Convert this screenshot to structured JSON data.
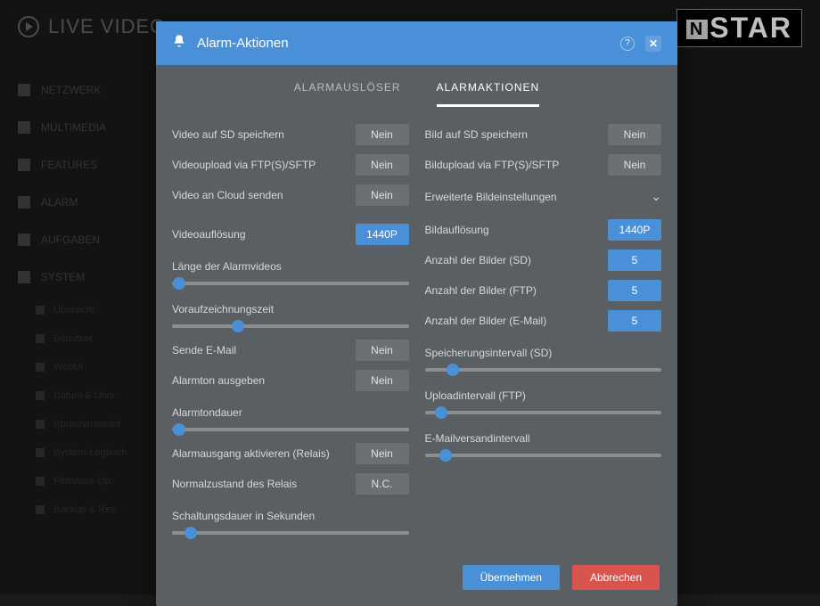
{
  "background": {
    "page_title": "LIVE VIDEO",
    "logo": "STAR",
    "logo_prefix": "N",
    "nav": [
      "NETZWERK",
      "MULTIMEDIA",
      "FEATURES",
      "ALARM",
      "AUFGABEN",
      "SYSTEM"
    ],
    "sub": [
      "Übersicht",
      "Benutzer",
      "WebUI",
      "Datum & Uhrz.",
      "Sprachauswahl",
      "System-Logbuch",
      "Firmware-Up.",
      "Backup & Res."
    ]
  },
  "modal": {
    "title": "Alarm-Aktionen",
    "tabs": {
      "trigger": "ALARMAUSLÖSER",
      "actions": "ALARMAKTIONEN"
    },
    "left": {
      "video_sd": {
        "label": "Video auf SD speichern",
        "value": "Nein"
      },
      "video_ftp": {
        "label": "Videoupload via FTP(S)/SFTP",
        "value": "Nein"
      },
      "video_cloud": {
        "label": "Video an Cloud senden",
        "value": "Nein"
      },
      "video_res": {
        "label": "Videoauflösung",
        "value": "1440P"
      },
      "video_len": {
        "label": "Länge der Alarmvideos",
        "pos": 3
      },
      "pre_rec": {
        "label": "Voraufzeichnungszeit",
        "pos": 28
      },
      "email": {
        "label": "Sende E-Mail",
        "value": "Nein"
      },
      "alarm_tone": {
        "label": "Alarmton ausgeben",
        "value": "Nein"
      },
      "tone_dur": {
        "label": "Alarmtondauer",
        "pos": 3
      },
      "relay": {
        "label": "Alarmausgang aktivieren (Relais)",
        "value": "Nein"
      },
      "relay_state": {
        "label": "Normalzustand des Relais",
        "value": "N.C."
      },
      "switch_dur": {
        "label": "Schaltungsdauer in Sekunden",
        "pos": 8
      }
    },
    "right": {
      "img_sd": {
        "label": "Bild auf SD speichern",
        "value": "Nein"
      },
      "img_ftp": {
        "label": "Bildupload via FTP(S)/SFTP",
        "value": "Nein"
      },
      "adv": {
        "label": "Erweiterte Bildeinstellungen"
      },
      "img_res": {
        "label": "Bildauflösung",
        "value": "1440P"
      },
      "count_sd": {
        "label": "Anzahl der Bilder (SD)",
        "value": "5"
      },
      "count_ftp": {
        "label": "Anzahl der Bilder (FTP)",
        "value": "5"
      },
      "count_email": {
        "label": "Anzahl der Bilder (E-Mail)",
        "value": "5"
      },
      "interval_sd": {
        "label": "Speicherungsintervall (SD)",
        "pos": 12
      },
      "interval_ftp": {
        "label": "Uploadintervall (FTP)",
        "pos": 7
      },
      "interval_email": {
        "label": "E-Mailversandintervall",
        "pos": 9
      }
    },
    "footer": {
      "apply": "Übernehmen",
      "cancel": "Abbrechen"
    }
  }
}
